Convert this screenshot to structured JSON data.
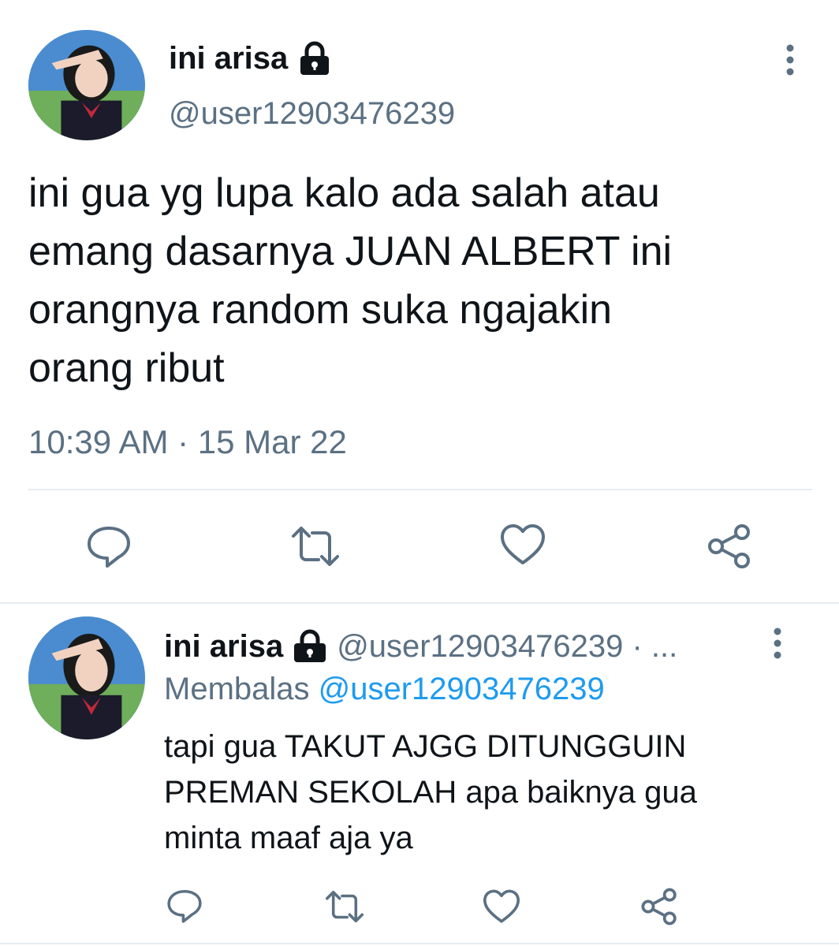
{
  "main_tweet": {
    "display_name": "ini arisa",
    "lock_icon": "lock-icon",
    "handle": "@user12903476239",
    "text_lines": [
      "ini gua yg lupa kalo ada salah atau",
      "emang dasarnya JUAN ALBERT ini",
      "orangnya random suka ngajakin",
      "orang ribut"
    ],
    "timestamp": "10:39 AM · 15 Mar 22",
    "actions": [
      "reply-icon",
      "retweet-icon",
      "like-icon",
      "share-icon"
    ]
  },
  "reply_tweet": {
    "display_name": "ini arisa",
    "lock_icon": "lock-icon",
    "handle_meta": "@user12903476239 · ...",
    "replying_prefix": "Membalas",
    "replying_to": "@user12903476239",
    "text_lines": [
      "tapi gua TAKUT AJGG DITUNGGUIN",
      "PREMAN SEKOLAH apa baiknya gua",
      "minta maaf aja ya"
    ],
    "actions": [
      "reply-icon",
      "retweet-icon",
      "like-icon",
      "share-icon"
    ]
  },
  "colors": {
    "text": "#0f1419",
    "muted": "#5b7083",
    "link": "#1d9bf0",
    "divider": "#e6ecf0"
  }
}
